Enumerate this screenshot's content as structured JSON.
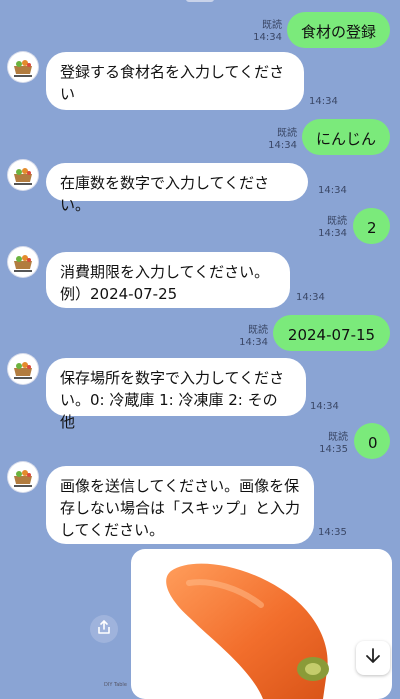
{
  "messages": [
    {
      "side": "me",
      "text": "食材の登録",
      "read": "既読",
      "time": "14:34"
    },
    {
      "side": "bot",
      "text": "登録する食材名を入力してください",
      "time": "14:34"
    },
    {
      "side": "me",
      "text": "にんじん",
      "read": "既読",
      "time": "14:34"
    },
    {
      "side": "bot",
      "text": "在庫数を数字で入力してください。",
      "time": "14:34"
    },
    {
      "side": "me",
      "text": "2",
      "read": "既読",
      "time": "14:34"
    },
    {
      "side": "bot",
      "text": "消費期限を入力してください。\n例）2024-07-25",
      "time": "14:34"
    },
    {
      "side": "me",
      "text": "2024-07-15",
      "read": "既読",
      "time": "14:34"
    },
    {
      "side": "bot",
      "text": "保存場所を数字で入力してください。0: 冷蔵庫 1: 冷凍庫 2: その他",
      "time": "14:34"
    },
    {
      "side": "me",
      "text": "0",
      "read": "既読",
      "time": "14:35"
    },
    {
      "side": "bot",
      "text": "画像を送信してください。画像を保存しない場合は「スキップ」と入力してください。",
      "time": "14:35"
    }
  ],
  "photo": {
    "subject": "carrot"
  },
  "bottom": {
    "tiny_text": "DIY Table"
  },
  "icons": {
    "share": "share-icon",
    "scroll": "arrow-down-icon",
    "avatar": "bot-avatar"
  },
  "colors": {
    "background": "#8aa4d4",
    "my_bubble": "#7bea7b",
    "bot_bubble": "#ffffff"
  }
}
